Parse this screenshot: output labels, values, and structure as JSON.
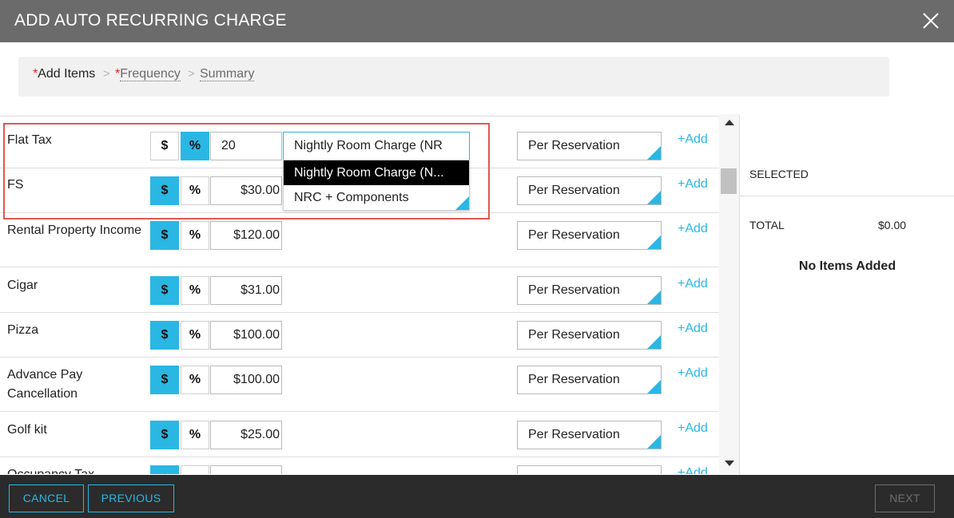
{
  "dialog": {
    "title": "ADD AUTO RECURRING CHARGE",
    "close_icon": "close-icon"
  },
  "steps": {
    "required_marker": "*",
    "add_items": "Add Items",
    "separator": ">",
    "frequency": "Frequency",
    "summary": "Summary"
  },
  "colors": {
    "accent": "#2ab7e4",
    "header_bg": "#6b6b6b",
    "footer_bg": "#2b2b2b",
    "highlight_border": "#e0584f"
  },
  "toggle_labels": {
    "dollar": "$",
    "percent": "%"
  },
  "items": [
    {
      "name": "Flat Tax",
      "mode": "percent",
      "amount": "20",
      "basis": "Per Reservation",
      "add_label": "+Add"
    },
    {
      "name": "FS",
      "mode": "dollar",
      "amount": "$30.00",
      "basis": "Per Reservation",
      "add_label": "+Add"
    },
    {
      "name": "Rental Property Income",
      "mode": "dollar",
      "amount": "$120.00",
      "basis": "Per Reservation",
      "add_label": "+Add"
    },
    {
      "name": "Cigar",
      "mode": "dollar",
      "amount": "$31.00",
      "basis": "Per Reservation",
      "add_label": "+Add"
    },
    {
      "name": "Pizza",
      "mode": "dollar",
      "amount": "$100.00",
      "basis": "Per Reservation",
      "add_label": "+Add"
    },
    {
      "name": "Advance Pay Cancellation",
      "mode": "dollar",
      "amount": "$100.00",
      "basis": "Per Reservation",
      "add_label": "+Add"
    },
    {
      "name": "Golf kit",
      "mode": "dollar",
      "amount": "$25.00",
      "basis": "Per Reservation",
      "add_label": "+Add"
    },
    {
      "name": "Occupancy Tax",
      "mode": "dollar",
      "amount": "",
      "basis": "",
      "add_label": "+Add"
    }
  ],
  "percent_dropdown": {
    "value": "Nightly Room Charge (NR",
    "options": [
      "Nightly Room Charge (N...",
      "NRC + Components"
    ],
    "active_index": 0
  },
  "summary_panel": {
    "selected_label": "SELECTED",
    "total_label": "TOTAL",
    "total_value": "$0.00",
    "empty_message": "No Items Added"
  },
  "footer": {
    "cancel": "CANCEL",
    "previous": "PREVIOUS",
    "next": "NEXT"
  }
}
